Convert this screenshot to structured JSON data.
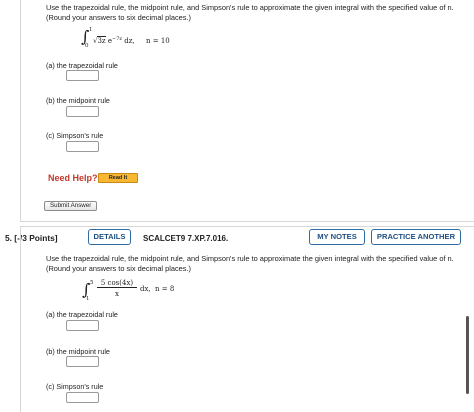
{
  "question_4": {
    "prompt_line1": "Use the trapezoidal rule, the midpoint rule, and Simpson's rule to approximate the given integral with the specified value of n.",
    "prompt_line2": "(Round your answers to six decimal places.)",
    "integral": {
      "lower": "0",
      "upper": "1",
      "integrand_root": "3z",
      "integrand_exp_base": "e",
      "integrand_exp": "−7z",
      "differential": "dz,",
      "n_label": "n = 10"
    },
    "parts": [
      {
        "label": "(a)   the trapezoidal rule",
        "value": ""
      },
      {
        "label": "(b)   the midpoint rule",
        "value": ""
      },
      {
        "label": "(c)   Simpson's rule",
        "value": ""
      }
    ],
    "need_help": "Need Help?",
    "read_it": "Read It",
    "submit": "Submit Answer"
  },
  "question_5": {
    "number": "5.  [-/3 Points]",
    "details": "DETAILS",
    "code": "SCALCET9 7.XP.7.016.",
    "my_notes": "MY NOTES",
    "practice_another": "PRACTICE ANOTHER",
    "prompt_line1": "Use the trapezoidal rule, the midpoint rule, and Simpson's rule to approximate the given integral with the specified value of n.",
    "prompt_line2": "(Round your answers to six decimal places.)",
    "integral": {
      "lower": "1",
      "upper": "5",
      "numerator": "5 cos(4x)",
      "denominator": "x",
      "differential": "dx,",
      "n_label": "n = 8"
    },
    "parts": [
      {
        "label": "(a)   the trapezoidal rule",
        "value": ""
      },
      {
        "label": "(b)   the midpoint rule",
        "value": ""
      },
      {
        "label": "(c)   Simpson's rule",
        "value": ""
      }
    ]
  },
  "colors": {
    "need_help": "#c0392b",
    "read_it_bg": "#f7b733",
    "button_border": "#2e6da4"
  }
}
